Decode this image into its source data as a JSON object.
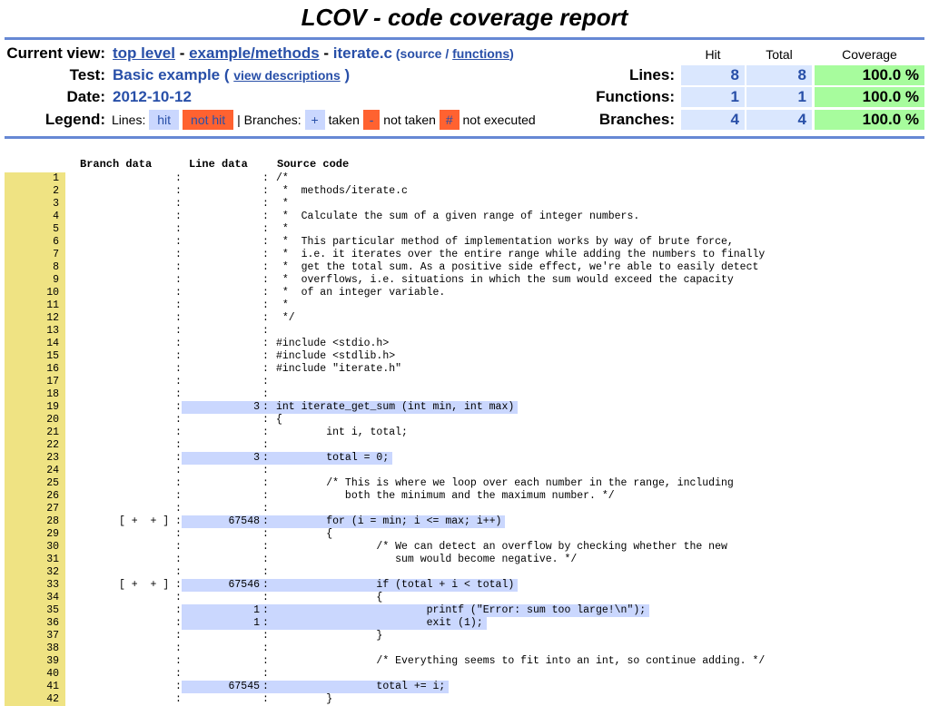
{
  "title": "LCOV - code coverage report",
  "header": {
    "current_view_label": "Current view:",
    "crumb_top": "top level",
    "crumb_sep1": " - ",
    "crumb_dir": "example/methods",
    "crumb_sep2": " - ",
    "crumb_file": "iterate.c",
    "source_open": " (source / ",
    "functions_link": "functions",
    "source_close": ")",
    "test_label": "Test:",
    "test_value": "Basic example ( ",
    "view_descriptions": "view descriptions",
    "test_close": " )",
    "date_label": "Date:",
    "date_value": "2012-10-12",
    "legend_label": "Legend:",
    "legend": {
      "lines_label": "Lines: ",
      "hit": "hit",
      "not_hit": "not hit",
      "branches_label": " | Branches: ",
      "taken_box": "+",
      "taken": " taken ",
      "not_taken_box": "-",
      "not_taken": " not taken ",
      "not_exec_box": "#",
      "not_executed": " not executed"
    }
  },
  "summary": {
    "col_hit": "Hit",
    "col_total": "Total",
    "col_coverage": "Coverage",
    "rows": [
      {
        "label": "Lines:",
        "hit": "8",
        "total": "8",
        "coverage": "100.0 %"
      },
      {
        "label": "Functions:",
        "hit": "1",
        "total": "1",
        "coverage": "100.0 %"
      },
      {
        "label": "Branches:",
        "hit": "4",
        "total": "4",
        "coverage": "100.0 %"
      }
    ]
  },
  "source_headers": {
    "branch": "Branch data",
    "line": "Line data",
    "source": "Source code"
  },
  "colors": {
    "rule": "#6688d4",
    "link": "#284fa8",
    "hit": "#cad7fe",
    "not_hit": "#ff6230",
    "coverage_hi": "#a7fc9d",
    "line_number_bg": "#efe383"
  },
  "lines": [
    {
      "n": "1",
      "br": "",
      "cnt": "",
      "hit": false,
      "src": "/*"
    },
    {
      "n": "2",
      "br": "",
      "cnt": "",
      "hit": false,
      "src": " *  methods/iterate.c"
    },
    {
      "n": "3",
      "br": "",
      "cnt": "",
      "hit": false,
      "src": " *"
    },
    {
      "n": "4",
      "br": "",
      "cnt": "",
      "hit": false,
      "src": " *  Calculate the sum of a given range of integer numbers."
    },
    {
      "n": "5",
      "br": "",
      "cnt": "",
      "hit": false,
      "src": " *"
    },
    {
      "n": "6",
      "br": "",
      "cnt": "",
      "hit": false,
      "src": " *  This particular method of implementation works by way of brute force,"
    },
    {
      "n": "7",
      "br": "",
      "cnt": "",
      "hit": false,
      "src": " *  i.e. it iterates over the entire range while adding the numbers to finally"
    },
    {
      "n": "8",
      "br": "",
      "cnt": "",
      "hit": false,
      "src": " *  get the total sum. As a positive side effect, we're able to easily detect"
    },
    {
      "n": "9",
      "br": "",
      "cnt": "",
      "hit": false,
      "src": " *  overflows, i.e. situations in which the sum would exceed the capacity"
    },
    {
      "n": "10",
      "br": "",
      "cnt": "",
      "hit": false,
      "src": " *  of an integer variable."
    },
    {
      "n": "11",
      "br": "",
      "cnt": "",
      "hit": false,
      "src": " *"
    },
    {
      "n": "12",
      "br": "",
      "cnt": "",
      "hit": false,
      "src": " */"
    },
    {
      "n": "13",
      "br": "",
      "cnt": "",
      "hit": false,
      "src": ""
    },
    {
      "n": "14",
      "br": "",
      "cnt": "",
      "hit": false,
      "src": "#include <stdio.h>"
    },
    {
      "n": "15",
      "br": "",
      "cnt": "",
      "hit": false,
      "src": "#include <stdlib.h>"
    },
    {
      "n": "16",
      "br": "",
      "cnt": "",
      "hit": false,
      "src": "#include \"iterate.h\""
    },
    {
      "n": "17",
      "br": "",
      "cnt": "",
      "hit": false,
      "src": ""
    },
    {
      "n": "18",
      "br": "",
      "cnt": "",
      "hit": false,
      "src": ""
    },
    {
      "n": "19",
      "br": "",
      "cnt": "3",
      "hit": true,
      "src": "int iterate_get_sum (int min, int max)"
    },
    {
      "n": "20",
      "br": "",
      "cnt": "",
      "hit": false,
      "src": "{"
    },
    {
      "n": "21",
      "br": "",
      "cnt": "",
      "hit": false,
      "src": "        int i, total;"
    },
    {
      "n": "22",
      "br": "",
      "cnt": "",
      "hit": false,
      "src": ""
    },
    {
      "n": "23",
      "br": "",
      "cnt": "3",
      "hit": true,
      "src": "        total = 0;"
    },
    {
      "n": "24",
      "br": "",
      "cnt": "",
      "hit": false,
      "src": ""
    },
    {
      "n": "25",
      "br": "",
      "cnt": "",
      "hit": false,
      "src": "        /* This is where we loop over each number in the range, including"
    },
    {
      "n": "26",
      "br": "",
      "cnt": "",
      "hit": false,
      "src": "           both the minimum and the maximum number. */"
    },
    {
      "n": "27",
      "br": "",
      "cnt": "",
      "hit": false,
      "src": ""
    },
    {
      "n": "28",
      "br": "[ +  + ]",
      "cnt": "67548",
      "hit": true,
      "src": "        for (i = min; i <= max; i++)"
    },
    {
      "n": "29",
      "br": "",
      "cnt": "",
      "hit": false,
      "src": "        {"
    },
    {
      "n": "30",
      "br": "",
      "cnt": "",
      "hit": false,
      "src": "                /* We can detect an overflow by checking whether the new"
    },
    {
      "n": "31",
      "br": "",
      "cnt": "",
      "hit": false,
      "src": "                   sum would become negative. */"
    },
    {
      "n": "32",
      "br": "",
      "cnt": "",
      "hit": false,
      "src": ""
    },
    {
      "n": "33",
      "br": "[ +  + ]",
      "cnt": "67546",
      "hit": true,
      "src": "                if (total + i < total)"
    },
    {
      "n": "34",
      "br": "",
      "cnt": "",
      "hit": false,
      "src": "                {"
    },
    {
      "n": "35",
      "br": "",
      "cnt": "1",
      "hit": true,
      "src": "                        printf (\"Error: sum too large!\\n\");"
    },
    {
      "n": "36",
      "br": "",
      "cnt": "1",
      "hit": true,
      "src": "                        exit (1);"
    },
    {
      "n": "37",
      "br": "",
      "cnt": "",
      "hit": false,
      "src": "                }"
    },
    {
      "n": "38",
      "br": "",
      "cnt": "",
      "hit": false,
      "src": ""
    },
    {
      "n": "39",
      "br": "",
      "cnt": "",
      "hit": false,
      "src": "                /* Everything seems to fit into an int, so continue adding. */"
    },
    {
      "n": "40",
      "br": "",
      "cnt": "",
      "hit": false,
      "src": ""
    },
    {
      "n": "41",
      "br": "",
      "cnt": "67545",
      "hit": true,
      "src": "                total += i;"
    },
    {
      "n": "42",
      "br": "",
      "cnt": "",
      "hit": false,
      "src": "        }"
    }
  ]
}
